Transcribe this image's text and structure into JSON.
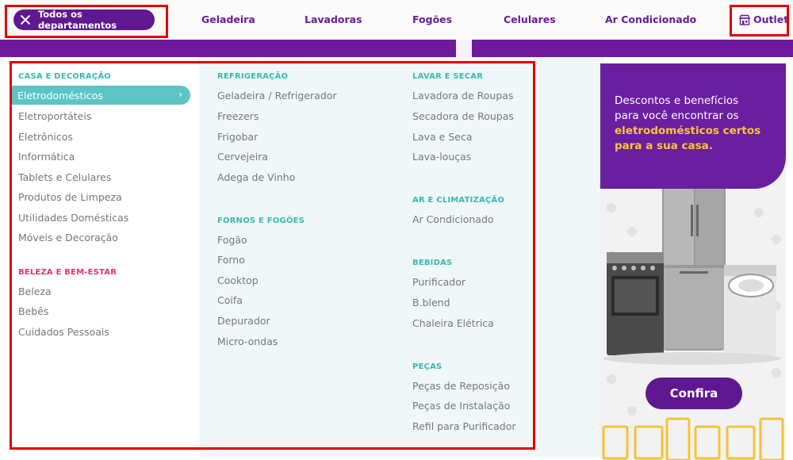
{
  "topnav": {
    "dept_button": "Todos os departamentos",
    "links": [
      "Geladeira",
      "Lavadoras",
      "Fogões",
      "Celulares",
      "Ar Condicionado"
    ],
    "outlet": "Outlet"
  },
  "menu": {
    "col1": {
      "section1": "CASA E DECORAÇÃO",
      "active_item": "Eletrodomésticos",
      "items1": [
        "Eletroportáteis",
        "Eletrônicos",
        "Informática",
        "Tablets e Celulares",
        "Produtos de Limpeza",
        "Utilidades Domésticas",
        "Móveis e Decoração"
      ],
      "section2": "BELEZA E BEM-ESTAR",
      "items2": [
        "Beleza",
        "Bebês",
        "Cuidados Pessoais"
      ]
    },
    "col2": {
      "section1": "REFRIGERAÇÃO",
      "items1": [
        "Geladeira / Refrigerador",
        "Freezers",
        "Frigobar",
        "Cervejeira",
        "Adega de Vinho"
      ],
      "section2": "FORNOS E FOGÕES",
      "items2": [
        "Fogão",
        "Forno",
        "Cooktop",
        "Coifa",
        "Depurador",
        "Micro-ondas"
      ]
    },
    "col3": {
      "section1": "LAVAR E SECAR",
      "items1": [
        "Lavadora de Roupas",
        "Secadora de Roupas",
        "Lava e Seca",
        "Lava-louças"
      ],
      "section2": "AR E CLIMATIZAÇÃO",
      "items2": [
        "Ar Condicionado"
      ],
      "section3": "BEBIDAS",
      "items3": [
        "Purificador",
        "B.blend",
        "Chaleira Elétrica"
      ],
      "section4": "PEÇAS",
      "items4": [
        "Peças de Reposição",
        "Peças de Instalação",
        "Refil para Purificador"
      ]
    }
  },
  "banner": {
    "line1": "Descontos e benefícios",
    "line2": "para você encontrar os",
    "line3": "eletrodomésticos certos",
    "line4": "para a sua casa.",
    "button": "Confira"
  },
  "colors": {
    "brand_purple": "#5f1890",
    "teal": "#5cc4c4",
    "pink_section": "#e4346d",
    "highlight_yellow": "#ffc33a",
    "annotation_red": "#e00000"
  }
}
